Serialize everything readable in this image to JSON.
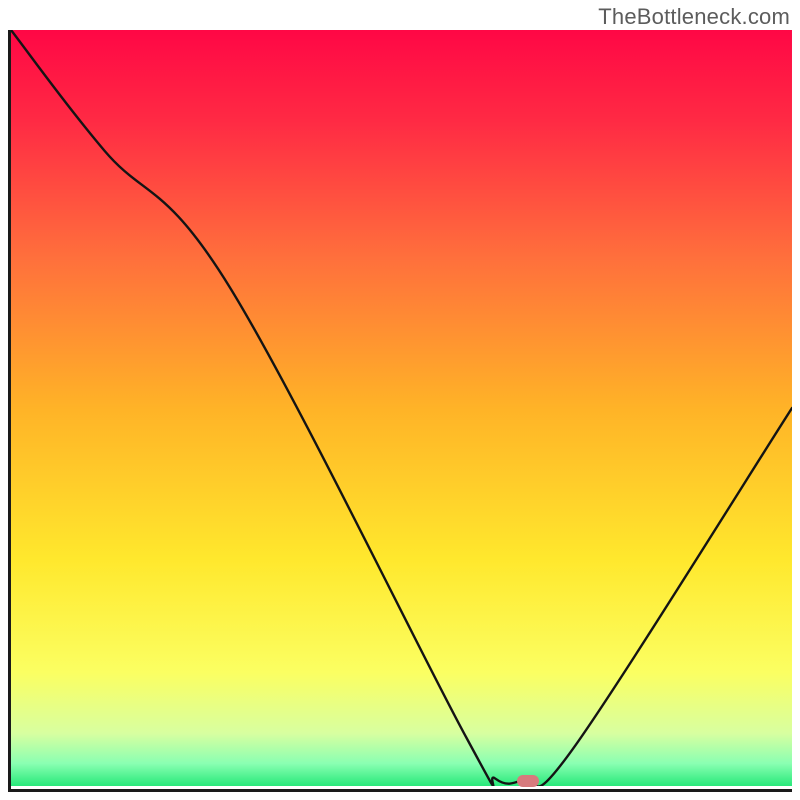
{
  "watermark": "TheBottleneck.com",
  "chart_data": {
    "type": "line",
    "title": "",
    "xlabel": "",
    "ylabel": "",
    "xlim": [
      0,
      100
    ],
    "ylim": [
      0,
      100
    ],
    "grid": false,
    "series": [
      {
        "name": "bottleneck-curve",
        "x": [
          0,
          12,
          28,
          58,
          62,
          66,
          72,
          100
        ],
        "values": [
          100,
          84,
          66,
          7,
          1,
          1,
          5,
          50
        ]
      }
    ],
    "annotations": [
      {
        "name": "optimal-marker",
        "x": 66,
        "y": 1,
        "color": "#d77a7d"
      }
    ],
    "background_gradient": {
      "stops": [
        {
          "offset": 0.0,
          "color": "#ff0745"
        },
        {
          "offset": 0.12,
          "color": "#ff2a44"
        },
        {
          "offset": 0.3,
          "color": "#ff6f3c"
        },
        {
          "offset": 0.5,
          "color": "#ffb327"
        },
        {
          "offset": 0.7,
          "color": "#ffe82d"
        },
        {
          "offset": 0.85,
          "color": "#fbff62"
        },
        {
          "offset": 0.93,
          "color": "#d8ffa0"
        },
        {
          "offset": 0.97,
          "color": "#8affb2"
        },
        {
          "offset": 1.0,
          "color": "#27e879"
        }
      ]
    }
  }
}
